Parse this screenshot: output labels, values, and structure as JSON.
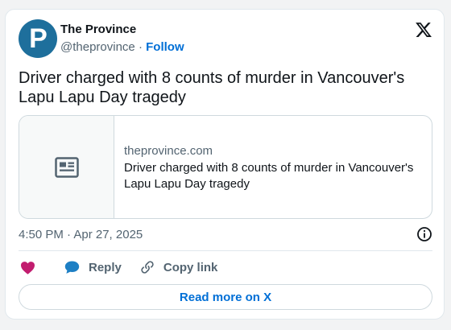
{
  "author": {
    "avatar_letter": "P",
    "name": "The Province",
    "handle": "@theprovince",
    "separator": "·",
    "follow_label": "Follow"
  },
  "tweet": {
    "text": "Driver charged with 8 counts of murder in Vancouver's Lapu Lapu Day tragedy"
  },
  "link_card": {
    "thumbnail_icon": "newspaper-icon",
    "domain": "theprovince.com",
    "title": "Driver charged with 8 counts of murder in Vancouver's Lapu Lapu Day tragedy"
  },
  "timestamp": "4:50 PM · Apr 27, 2025",
  "actions": {
    "like_icon": "heart-icon",
    "reply_label": "Reply",
    "copy_link_label": "Copy link"
  },
  "read_more_label": "Read more on X",
  "colors": {
    "link_blue": "#006fd6",
    "secondary_text": "#536471",
    "avatar_bg": "#1e6f9c",
    "heart": "#f91880",
    "reply_bubble": "#1d9bf0"
  }
}
